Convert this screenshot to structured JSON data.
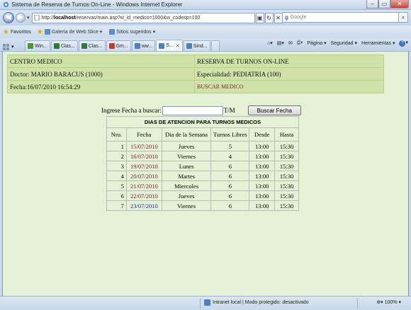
{
  "window": {
    "title": "Sistema de Reserva de Turnos On-Line - Windows Internet Explorer",
    "min": "–",
    "max": "▭",
    "close": "✕"
  },
  "address": {
    "prefix": "http://",
    "host": "localhost",
    "path": "/reservas/main.asp?w_id_medico=1000&w_codesp=100",
    "search_placeholder": "Google"
  },
  "favorites": {
    "label": "Favoritos",
    "links": [
      "Galería de Web Slice ▾",
      "Sitios sugeridos ▾"
    ]
  },
  "tabs": [
    {
      "label": "Win...",
      "color": "#4a9a2a"
    },
    {
      "label": "Clas...",
      "color": "#2a7a3a"
    },
    {
      "label": "Clas...",
      "color": "#2a7a3a"
    },
    {
      "label": "Gm...",
      "color": "#c43b2b"
    },
    {
      "label": "ww...",
      "color": "#4d7fc4"
    },
    {
      "label": "S...",
      "color": "#4d7fc4",
      "active": true
    },
    {
      "label": "Sind...",
      "color": "#4d7fc4"
    }
  ],
  "commandbar": {
    "page": "Página ▾",
    "safety": "Seguridad ▾",
    "tools": "Herramientas ▾",
    "help": "▾"
  },
  "header": {
    "center": "CENTRO MEDICO",
    "system": "RESERVA DE TURNOS ON-LINE",
    "doctor": "Doctor: MARIO BARACUS (1000)",
    "specialty": "Especialidad: PEDIATRIA (100)",
    "date": "Fecha:16/07/2010 16:54:29",
    "search_link": "BUSCAR MEDICO"
  },
  "search": {
    "label": "Ingrese Fecha a buscar:",
    "value": "",
    "format": "T/M",
    "button": "Buscar Fecha"
  },
  "table": {
    "title": "DIAS DE ATENCION PARA TURNOS MEDICOS",
    "columns": [
      "Nro.",
      "Fecha",
      "Dia de la Semana",
      "Turnos Libres",
      "Desde",
      "Hasta"
    ],
    "rows": [
      {
        "nro": "1",
        "fecha": "15/07/2010",
        "dia": "Jueves",
        "libres": "5",
        "desde": "13:00",
        "hasta": "15:30",
        "visited": false
      },
      {
        "nro": "2",
        "fecha": "16/07/2010",
        "dia": "Viernes",
        "libres": "4",
        "desde": "13:00",
        "hasta": "15:30",
        "visited": false
      },
      {
        "nro": "3",
        "fecha": "19/07/2010",
        "dia": "Lunes",
        "libres": "6",
        "desde": "13:00",
        "hasta": "15:30",
        "visited": false
      },
      {
        "nro": "4",
        "fecha": "20/07/2010",
        "dia": "Martes",
        "libres": "6",
        "desde": "13:00",
        "hasta": "15:30",
        "visited": false
      },
      {
        "nro": "5",
        "fecha": "21/07/2010",
        "dia": "Miercoles",
        "libres": "6",
        "desde": "13:00",
        "hasta": "15:30",
        "visited": false
      },
      {
        "nro": "6",
        "fecha": "22/07/2010",
        "dia": "Jueves",
        "libres": "6",
        "desde": "13:00",
        "hasta": "15:30",
        "visited": false
      },
      {
        "nro": "7",
        "fecha": "23/07/2010",
        "dia": "Viernes",
        "libres": "6",
        "desde": "13:00",
        "hasta": "15:30",
        "visited": true
      }
    ]
  },
  "status": {
    "zone": "Intranet local | Modo protegido: desactivado",
    "zoom": "100%"
  },
  "colors": {
    "content_bg": "#e4f1d4",
    "header_bg": "#cfe3a8",
    "link": "#7b1a3a",
    "visited_link": "#1a2fa8"
  }
}
